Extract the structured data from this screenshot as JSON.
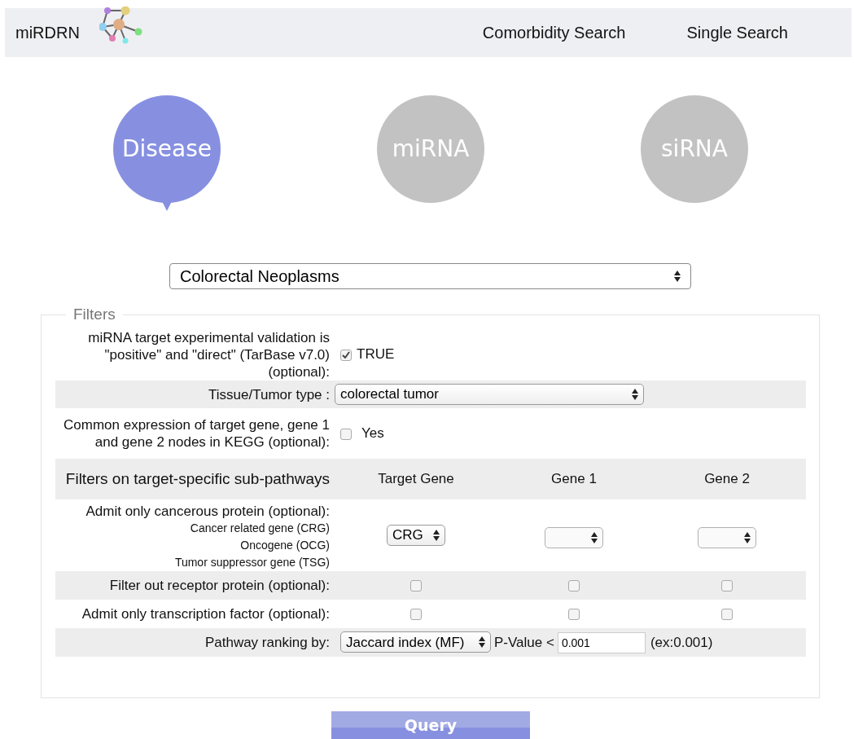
{
  "navbar": {
    "brand": "miRDRN",
    "links": [
      {
        "label": "Comorbidity Search"
      },
      {
        "label": "Single Search"
      }
    ]
  },
  "steps": [
    {
      "label": "Disease",
      "selected": true
    },
    {
      "label": "miRNA",
      "selected": false
    },
    {
      "label": "siRNA",
      "selected": false
    }
  ],
  "disease_select": {
    "value": "Colorectal Neoplasms"
  },
  "filters": {
    "legend": "Filters",
    "validation": {
      "label": "miRNA target experimental validation is \"positive\" and \"direct\" (TarBase v7.0) (optional):",
      "checked": true,
      "option": "TRUE"
    },
    "tissue": {
      "label": "Tissue/Tumor type :",
      "value": "colorectal tumor"
    },
    "kegg": {
      "label": "Common expression of target gene, gene 1 and gene 2 nodes in KEGG (optional):",
      "checked": false,
      "option": "Yes"
    },
    "subpathways": {
      "label": "Filters on target-specific sub-pathways",
      "columns": [
        "Target Gene",
        "Gene 1",
        "Gene 2"
      ]
    },
    "cancerous": {
      "label": "Admit only cancerous protein (optional):",
      "sub_labels": [
        "Cancer related gene (CRG)",
        "Oncogene (OCG)",
        "Tumor suppressor gene (TSG)"
      ],
      "selects": [
        {
          "empty": false,
          "value": "CRG"
        },
        {
          "empty": true
        },
        {
          "empty": true
        }
      ]
    },
    "receptor": {
      "label": "Filter out receptor protein (optional):",
      "checks": [
        false,
        false,
        false
      ]
    },
    "transcription": {
      "label": "Admit only transcription factor (optional):",
      "checks": [
        false,
        false,
        false
      ]
    },
    "ranking": {
      "label": "Pathway ranking by:",
      "method": "Jaccard index (MF)",
      "pvalue_label": "P-Value <",
      "pvalue": "0.001",
      "example": "(ex:0.001)"
    }
  },
  "query_button": "Query"
}
